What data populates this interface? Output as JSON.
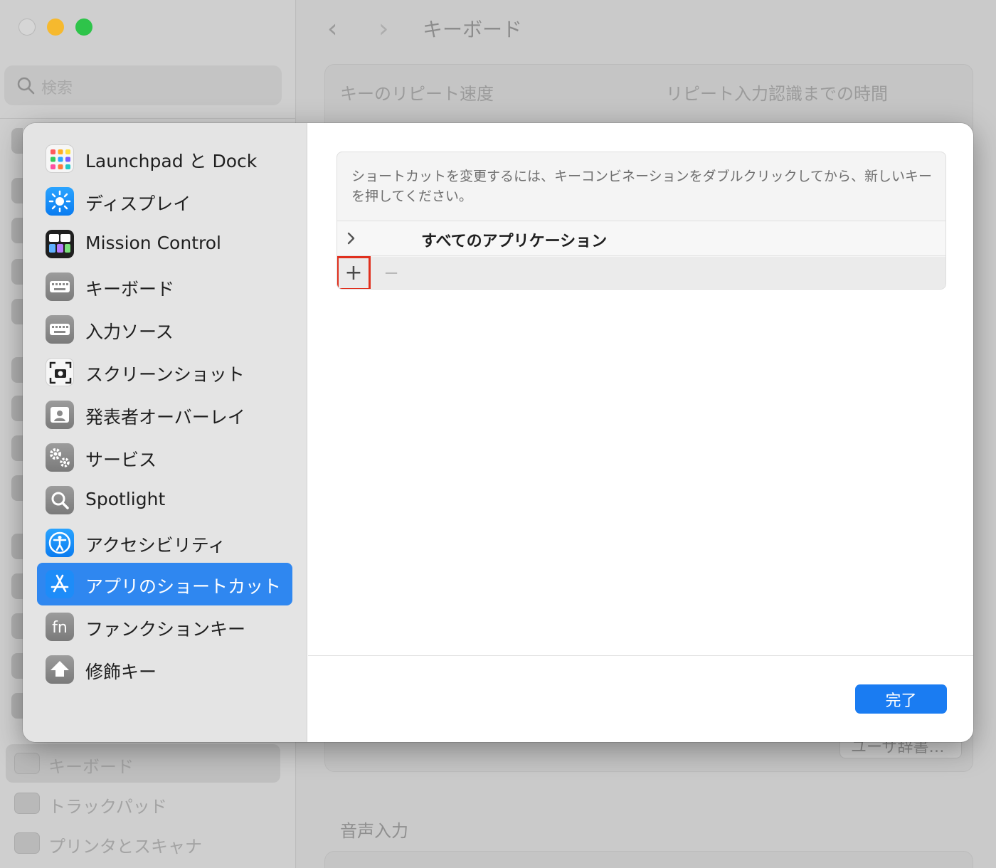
{
  "background": {
    "search_placeholder": "検索",
    "window_title": "キーボード",
    "back_icon": "chevron-left-icon",
    "forward_icon": "chevron-right-icon",
    "label_repeat_speed": "キーのリピート速度",
    "label_repeat_delay": "リピート入力認識までの時間",
    "dictionary_button": "ユーザ辞書…",
    "voice_input_heading": "音声入力",
    "sidebar_items": [
      {
        "label": "キーボード",
        "icon": "keyboard-icon"
      },
      {
        "label": "トラックパッド",
        "icon": "trackpad-icon"
      },
      {
        "label": "プリンタとスキャナ",
        "icon": "printer-icon"
      }
    ]
  },
  "sheet": {
    "categories": [
      {
        "label": "Launchpad と Dock",
        "icon": "launchpad-icon"
      },
      {
        "label": "ディスプレイ",
        "icon": "display-icon"
      },
      {
        "label": "Mission Control",
        "icon": "mission-control-icon"
      },
      {
        "label": "キーボード",
        "icon": "keyboard-icon"
      },
      {
        "label": "入力ソース",
        "icon": "input-source-icon"
      },
      {
        "label": "スクリーンショット",
        "icon": "screenshot-icon"
      },
      {
        "label": "発表者オーバーレイ",
        "icon": "presenter-overlay-icon"
      },
      {
        "label": "サービス",
        "icon": "services-gear-icon"
      },
      {
        "label": "Spotlight",
        "icon": "spotlight-icon"
      },
      {
        "label": "アクセシビリティ",
        "icon": "accessibility-icon"
      },
      {
        "label": "アプリのショートカット",
        "icon": "app-store-icon",
        "selected": true
      },
      {
        "label": "ファンクションキー",
        "icon": "fn-key-icon"
      },
      {
        "label": "修飾キー",
        "icon": "modifier-key-icon"
      }
    ],
    "instructions": "ショートカットを変更するには、キーコンビネーションをダブルクリックしてから、新しいキーを押してください。",
    "all_apps_label": "すべてのアプリケーション",
    "add_button": "+",
    "remove_button": "−",
    "done_button": "完了",
    "colors": {
      "selected": "#2f87f0",
      "done": "#1a7cf2",
      "highlight_box": "#e0301e"
    }
  }
}
